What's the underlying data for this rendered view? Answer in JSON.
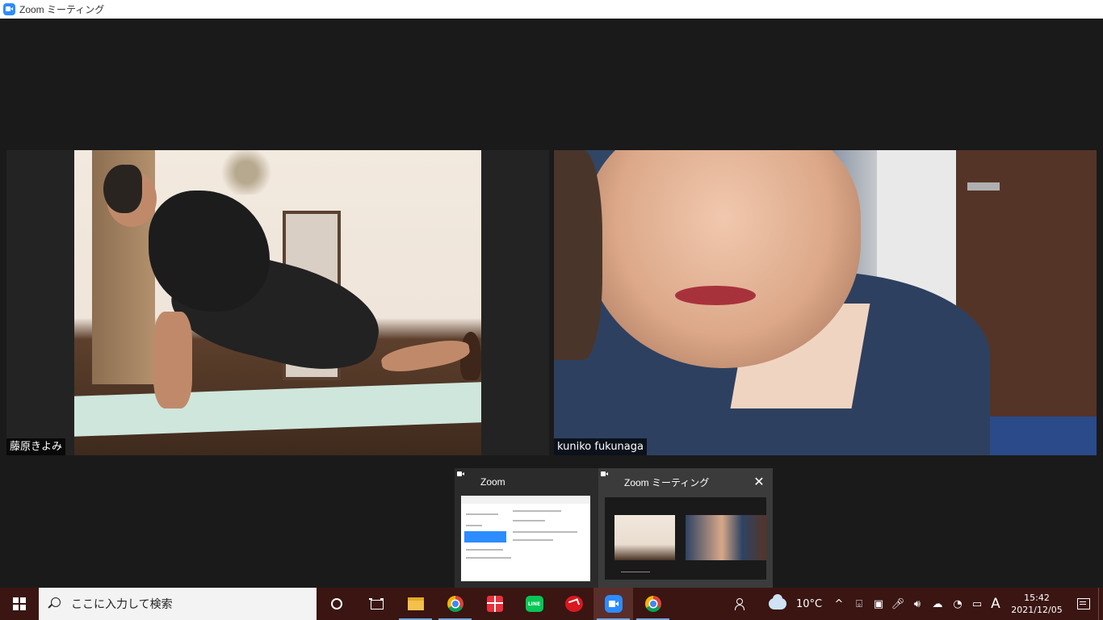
{
  "window": {
    "title": "Zoom ミーティング"
  },
  "participants": [
    {
      "name": "藤原きよみ"
    },
    {
      "name": "kuniko fukunaga"
    }
  ],
  "taskbar_preview": {
    "cards": [
      {
        "title": "Zoom"
      },
      {
        "title": "Zoom ミーティング",
        "close_glyph": "✕"
      }
    ]
  },
  "taskbar": {
    "search_placeholder": "ここに入力して検索",
    "apps": [
      {
        "id": "cortana",
        "icon": "cortana-icon"
      },
      {
        "id": "task-view",
        "icon": "task-view-icon"
      },
      {
        "id": "file-explorer",
        "icon": "folder-icon"
      },
      {
        "id": "chrome",
        "icon": "chrome-icon"
      },
      {
        "id": "gift",
        "icon": "gift-icon"
      },
      {
        "id": "line",
        "icon": "line-icon",
        "label": "LINE"
      },
      {
        "id": "trend-micro",
        "icon": "trend-micro-icon"
      },
      {
        "id": "zoom",
        "icon": "zoom-icon",
        "active": true
      },
      {
        "id": "chrome-2",
        "icon": "chrome-icon"
      }
    ],
    "tray": {
      "weather_temp": "10°C",
      "ime_label": "A",
      "time": "15:42",
      "date": "2021/12/05"
    }
  },
  "colors": {
    "taskbar_bg": "#3a1512",
    "meeting_bg": "#1a1a1a",
    "zoom_blue": "#2d8cff"
  }
}
